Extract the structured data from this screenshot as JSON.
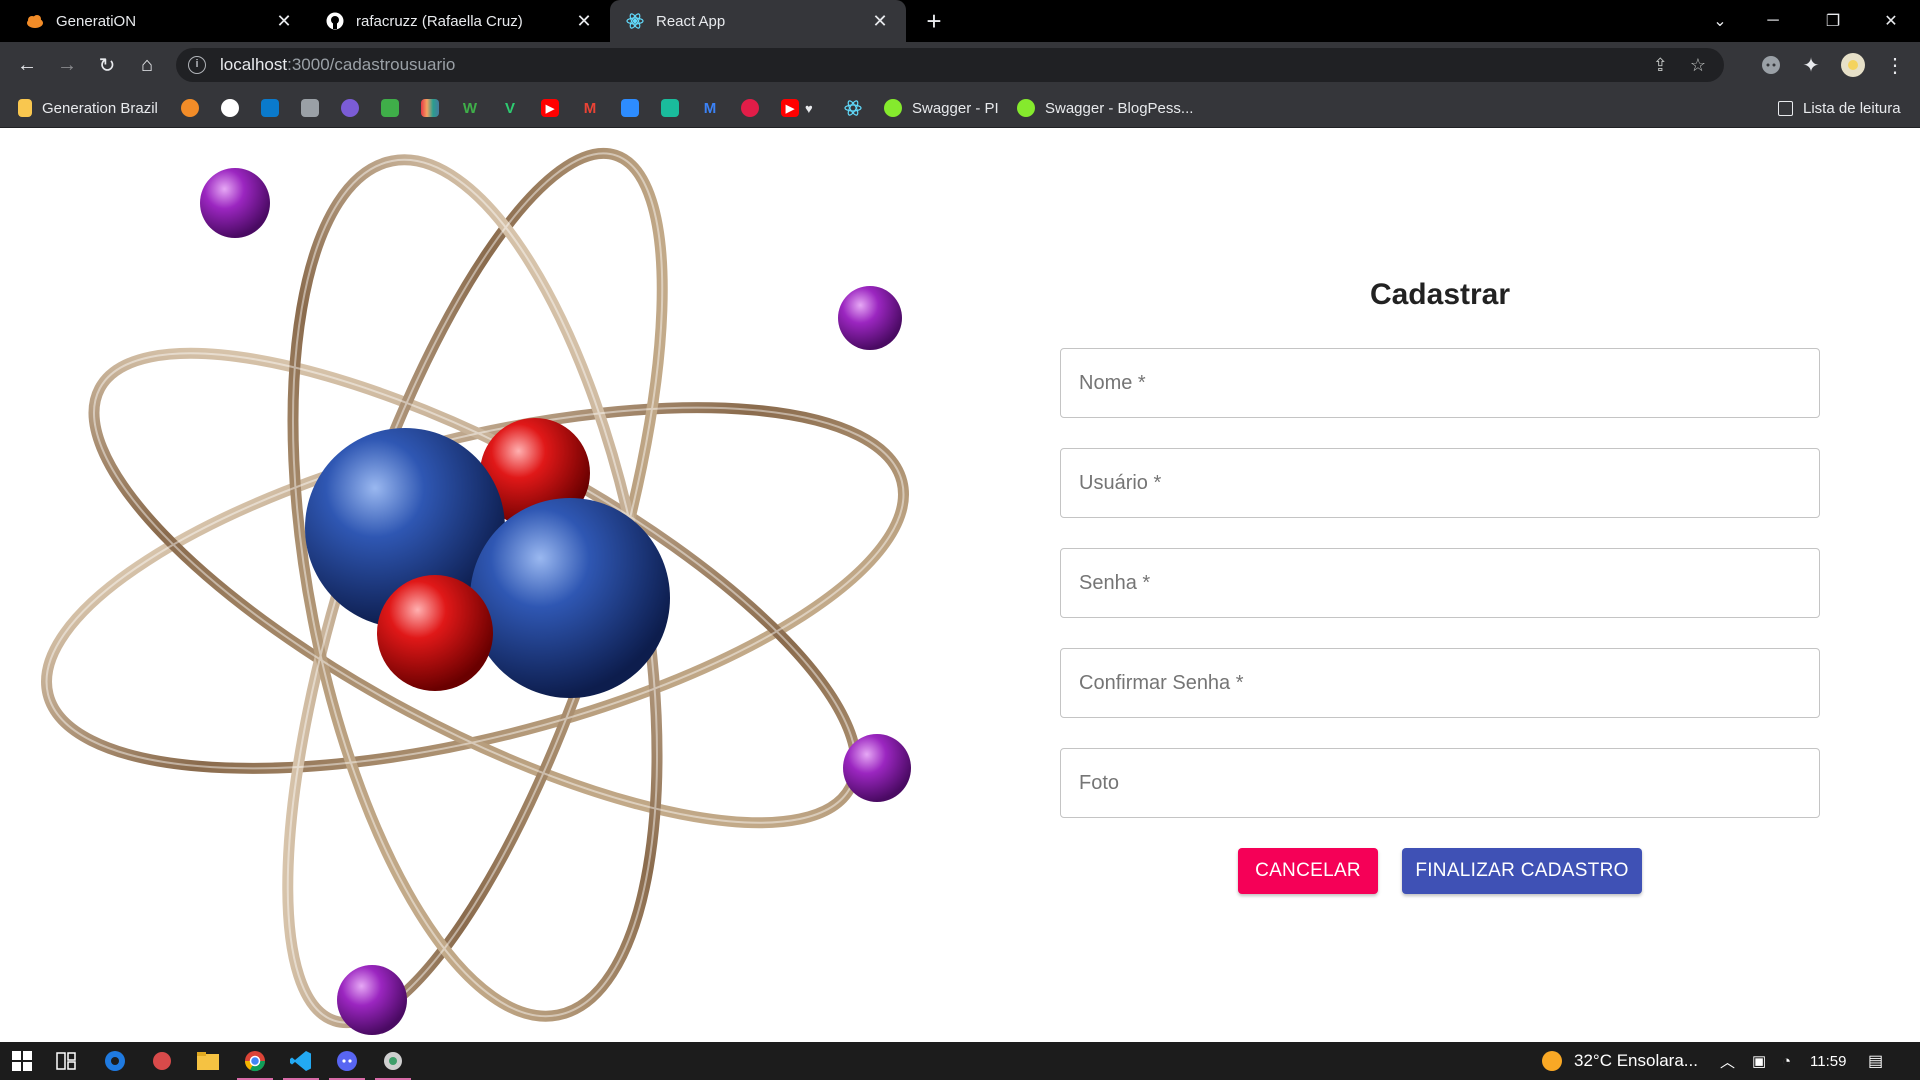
{
  "browser": {
    "tabs": [
      {
        "title": "GeneratiON",
        "favicon": "cloud-orange-icon",
        "active": false
      },
      {
        "title": "rafacruzz (Rafaella Cruz)",
        "favicon": "github-icon",
        "active": false
      },
      {
        "title": "React App",
        "favicon": "react-icon",
        "active": true
      }
    ],
    "address": {
      "host": "localhost",
      "path": ":3000/cadastrousuario"
    },
    "bookmarks": [
      {
        "label": "Generation Brazil",
        "icon": "folder-icon"
      },
      {
        "label": "Swagger - PI",
        "icon": "swagger-icon"
      },
      {
        "label": "Swagger - BlogPess...",
        "icon": "swagger-icon"
      }
    ],
    "reading_list": "Lista de leitura"
  },
  "form": {
    "title": "Cadastrar",
    "fields": [
      {
        "label": "Nome *"
      },
      {
        "label": "Usuário *"
      },
      {
        "label": "Senha *"
      },
      {
        "label": "Confirmar Senha *"
      },
      {
        "label": "Foto"
      }
    ],
    "cancel_label": "CANCELAR",
    "submit_label": "FINALIZAR CADASTRO"
  },
  "colors": {
    "cancel": "#f50057",
    "submit": "#3f51b5"
  },
  "taskbar": {
    "weather": "32°C  Ensolara...",
    "time": "11:59"
  }
}
